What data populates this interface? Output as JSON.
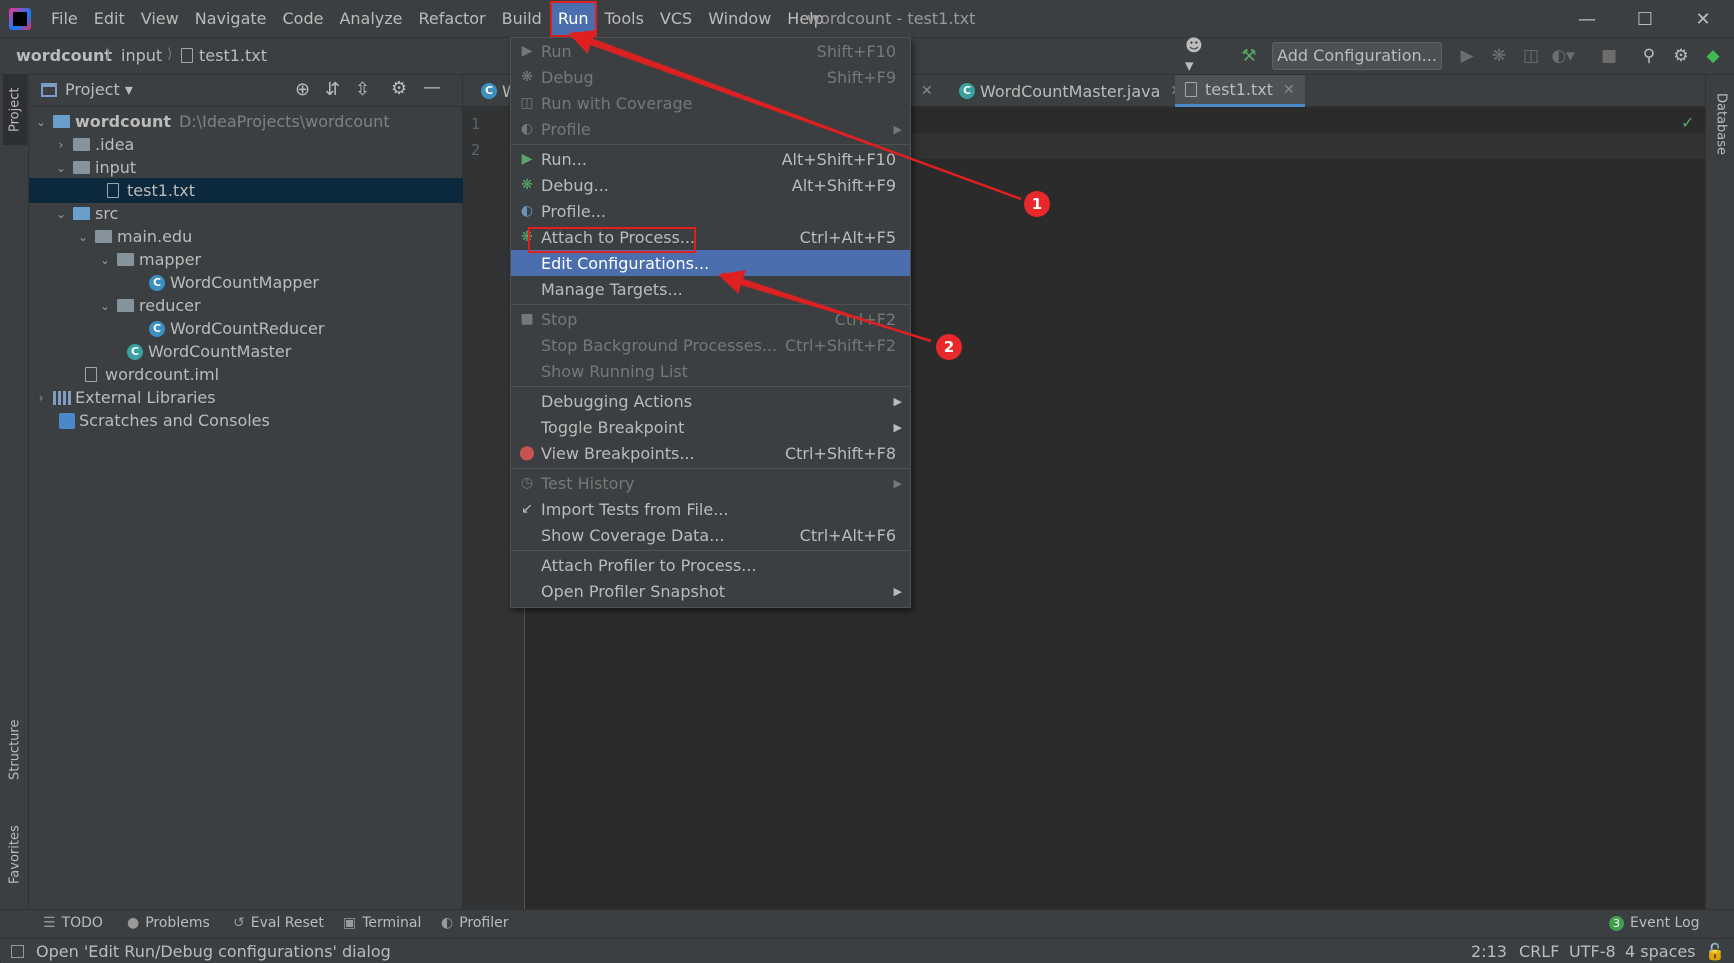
{
  "menubar": {
    "items": [
      "File",
      "Edit",
      "View",
      "Navigate",
      "Code",
      "Analyze",
      "Refactor",
      "Build",
      "Run",
      "Tools",
      "VCS",
      "Window",
      "Help"
    ],
    "active": "Run",
    "window_title": "wordcount - test1.txt"
  },
  "breadcrumb": [
    "wordcount",
    "input",
    "test1.txt"
  ],
  "toolbar": {
    "add_configuration": "Add Configuration..."
  },
  "project_panel": {
    "title": "Project",
    "tree": [
      {
        "label": "wordcount",
        "extra": "D:\\IdeaProjects\\wordcount",
        "bold": true
      },
      {
        "label": ".idea"
      },
      {
        "label": "input"
      },
      {
        "label": "test1.txt",
        "selected": true
      },
      {
        "label": "src"
      },
      {
        "label": "main.edu"
      },
      {
        "label": "mapper"
      },
      {
        "label": "WordCountMapper"
      },
      {
        "label": "reducer"
      },
      {
        "label": "WordCountReducer"
      },
      {
        "label": "WordCountMaster"
      },
      {
        "label": "wordcount.iml"
      },
      {
        "label": "External Libraries"
      },
      {
        "label": "Scratches and Consoles"
      }
    ]
  },
  "editor": {
    "tabs": [
      "W",
      "WordCountMaster.java",
      "test1.txt"
    ],
    "active_tab": "test1.txt",
    "line_numbers": [
      "1",
      "2"
    ]
  },
  "side_tabs": {
    "project": "Project",
    "structure": "Structure",
    "favorites": "Favorites",
    "database": "Database"
  },
  "run_menu": {
    "items": [
      {
        "label": "Run",
        "shortcut": "Shift+F10",
        "disabled": true
      },
      {
        "label": "Debug",
        "shortcut": "Shift+F9",
        "disabled": true
      },
      {
        "label": "Run with Coverage",
        "shortcut": "",
        "disabled": true
      },
      {
        "label": "Profile",
        "shortcut": "",
        "disabled": true,
        "submenu": true
      },
      {
        "label": "Run...",
        "shortcut": "Alt+Shift+F10"
      },
      {
        "label": "Debug...",
        "shortcut": "Alt+Shift+F9"
      },
      {
        "label": "Profile...",
        "shortcut": ""
      },
      {
        "label": "Attach to Process...",
        "shortcut": "Ctrl+Alt+F5"
      },
      {
        "label": "Edit Configurations...",
        "shortcut": "",
        "highlighted": true
      },
      {
        "label": "Manage Targets...",
        "shortcut": ""
      },
      {
        "label": "Stop",
        "shortcut": "Ctrl+F2",
        "disabled": true
      },
      {
        "label": "Stop Background Processes...",
        "shortcut": "Ctrl+Shift+F2",
        "disabled": true
      },
      {
        "label": "Show Running List",
        "shortcut": "",
        "disabled": true
      },
      {
        "label": "Debugging Actions",
        "shortcut": "",
        "submenu": true
      },
      {
        "label": "Toggle Breakpoint",
        "shortcut": "",
        "submenu": true
      },
      {
        "label": "View Breakpoints...",
        "shortcut": "Ctrl+Shift+F8"
      },
      {
        "label": "Test History",
        "shortcut": "",
        "disabled": true,
        "submenu": true
      },
      {
        "label": "Import Tests from File...",
        "shortcut": ""
      },
      {
        "label": "Show Coverage Data...",
        "shortcut": "Ctrl+Alt+F6"
      },
      {
        "label": "Attach Profiler to Process...",
        "shortcut": ""
      },
      {
        "label": "Open Profiler Snapshot",
        "shortcut": "",
        "submenu": true
      }
    ]
  },
  "bottom_tools": [
    "TODO",
    "Problems",
    "Eval Reset",
    "Terminal",
    "Profiler"
  ],
  "event_log": {
    "count": "3",
    "label": "Event Log"
  },
  "status": {
    "message": "Open 'Edit Run/Debug configurations' dialog",
    "position": "2:13",
    "line_sep": "CRLF",
    "encoding": "UTF-8",
    "indent": "4 spaces"
  },
  "annotations": [
    "1",
    "2"
  ],
  "colors": {
    "accent": "#4b6eaf",
    "annotation": "#e02020",
    "bg": "#2b2b2b",
    "panel": "#3c3f41"
  }
}
